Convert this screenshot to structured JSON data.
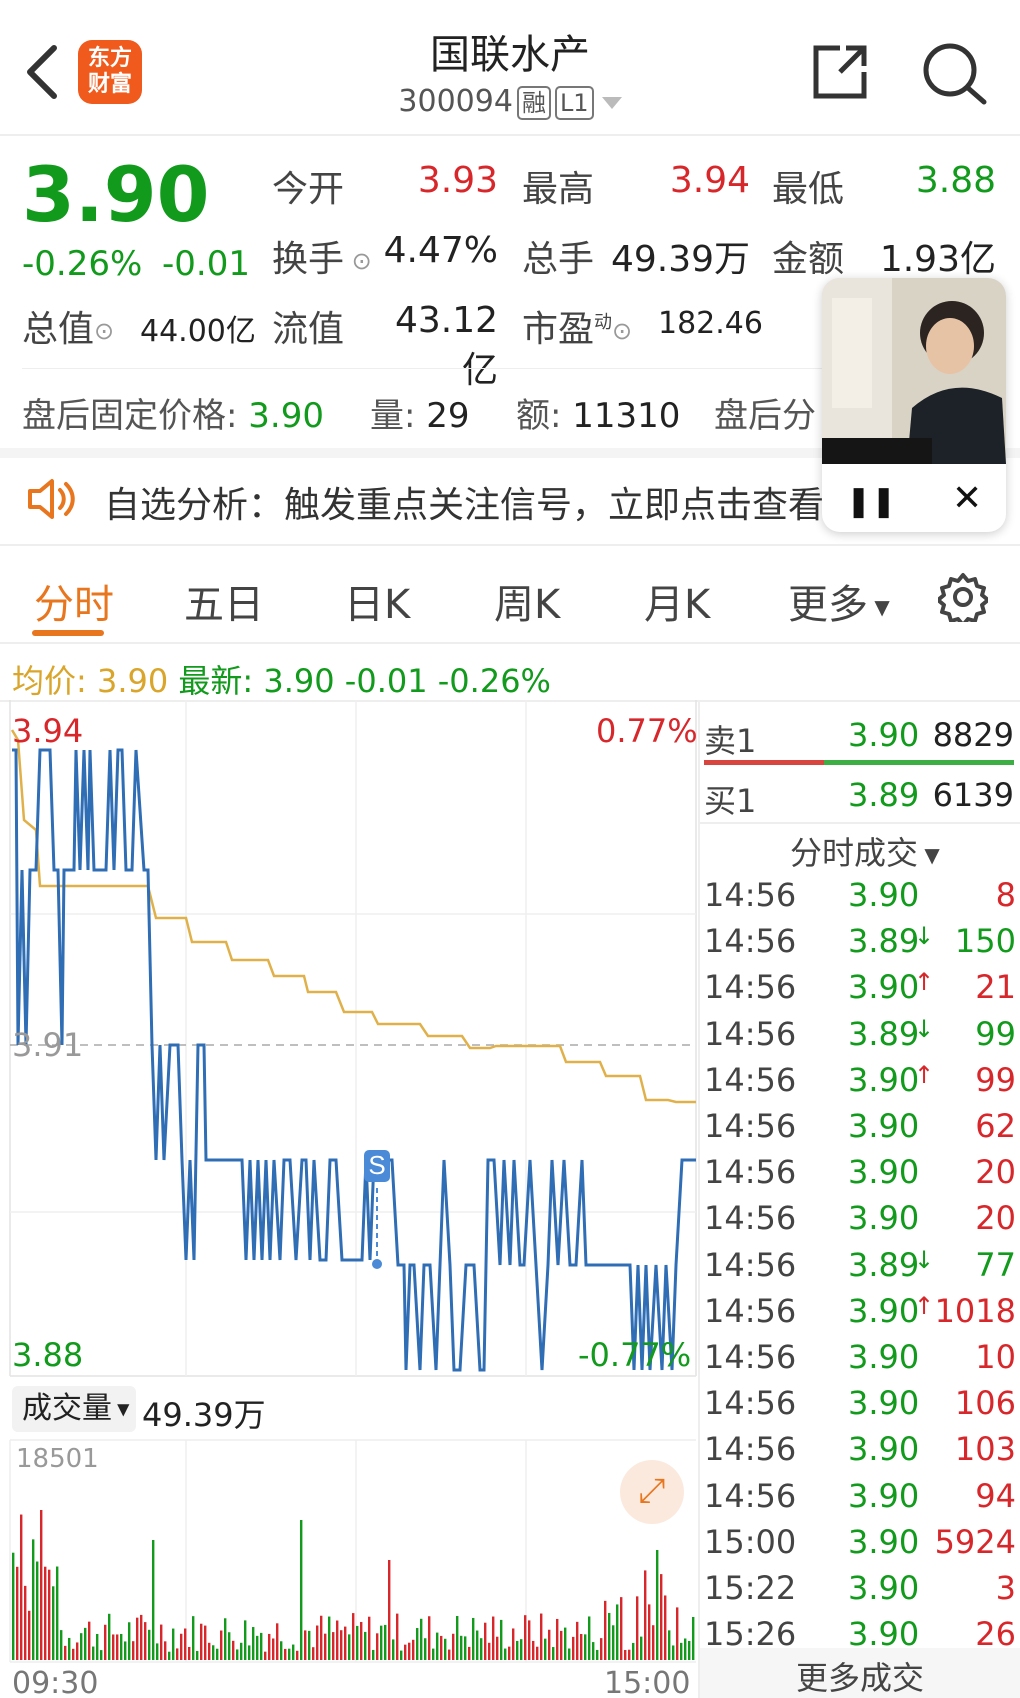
{
  "header": {
    "title": "国联水产",
    "code": "300094",
    "badge_rong": "融",
    "badge_level": "L1",
    "logo_line1": "东方",
    "logo_line2": "财富"
  },
  "quote": {
    "price": "3.90",
    "change_pct": "-0.26%",
    "change": "-0.01",
    "open_label": "今开",
    "open": "3.93",
    "high_label": "最高",
    "high": "3.94",
    "low_label": "最低",
    "low": "3.88",
    "turnover_label": "换手",
    "turnover": "4.47%",
    "volume_label": "总手",
    "volume": "49.39万",
    "amount_label": "金额",
    "amount": "1.93亿",
    "mktcap_label": "总值",
    "mktcap": "44.00亿",
    "float_label": "流值",
    "float_cap": "43.12亿",
    "pe_label": "市盈",
    "pe_sup": "动",
    "pe": "182.46"
  },
  "after_hours": {
    "price_label": "盘后固定价格:",
    "price": "3.90",
    "vol_label": "量:",
    "vol": "29",
    "amt_label": "额:",
    "amt": "11310",
    "more_label": "盘后分"
  },
  "notice": {
    "text": "自选分析：触发重点关注信号，立即点击查看"
  },
  "tabs": [
    "分时",
    "五日",
    "日K",
    "周K",
    "月K",
    "更多"
  ],
  "summary": {
    "avg_label": "均价:",
    "avg": "3.90",
    "last_label": "最新:",
    "last": "3.90",
    "change": "-0.01",
    "change_pct": "-0.26%"
  },
  "chart_labels": {
    "high": "3.94",
    "high_pct": "0.77%",
    "mid": "3.91",
    "low": "3.88",
    "low_pct": "-0.77%",
    "marker": "S",
    "vol_selector": "成交量",
    "vol_total": "49.39万",
    "vol_max": "18501",
    "time_start": "09:30",
    "time_end": "15:00"
  },
  "order_book": {
    "sell_label": "卖1",
    "sell_price": "3.90",
    "sell_vol": "8829",
    "buy_label": "买1",
    "buy_price": "3.89",
    "buy_vol": "6139"
  },
  "ticks_header": "分时成交",
  "ticks": [
    {
      "t": "14:56",
      "p": "3.90",
      "a": "",
      "v": "8"
    },
    {
      "t": "14:56",
      "p": "3.89",
      "a": "↓",
      "v": "150"
    },
    {
      "t": "14:56",
      "p": "3.90",
      "a": "↑",
      "v": "21"
    },
    {
      "t": "14:56",
      "p": "3.89",
      "a": "↓",
      "v": "99"
    },
    {
      "t": "14:56",
      "p": "3.90",
      "a": "↑",
      "v": "99"
    },
    {
      "t": "14:56",
      "p": "3.90",
      "a": "",
      "v": "62"
    },
    {
      "t": "14:56",
      "p": "3.90",
      "a": "",
      "v": "20"
    },
    {
      "t": "14:56",
      "p": "3.90",
      "a": "",
      "v": "20"
    },
    {
      "t": "14:56",
      "p": "3.89",
      "a": "↓",
      "v": "77"
    },
    {
      "t": "14:56",
      "p": "3.90",
      "a": "↑",
      "v": "1018"
    },
    {
      "t": "14:56",
      "p": "3.90",
      "a": "",
      "v": "10"
    },
    {
      "t": "14:56",
      "p": "3.90",
      "a": "",
      "v": "106"
    },
    {
      "t": "14:56",
      "p": "3.90",
      "a": "",
      "v": "103"
    },
    {
      "t": "14:56",
      "p": "3.90",
      "a": "",
      "v": "94"
    },
    {
      "t": "15:00",
      "p": "3.90",
      "a": "",
      "v": "5924"
    },
    {
      "t": "15:22",
      "p": "3.90",
      "a": "",
      "v": "3"
    },
    {
      "t": "15:26",
      "p": "3.90",
      "a": "",
      "v": "26"
    }
  ],
  "more_ticks": "更多成交",
  "colors": {
    "up": "#d8272b",
    "down": "#129a1c",
    "accent": "#e8761f",
    "price_line": "#2f6db5",
    "avg_line": "#e0b14a"
  }
}
